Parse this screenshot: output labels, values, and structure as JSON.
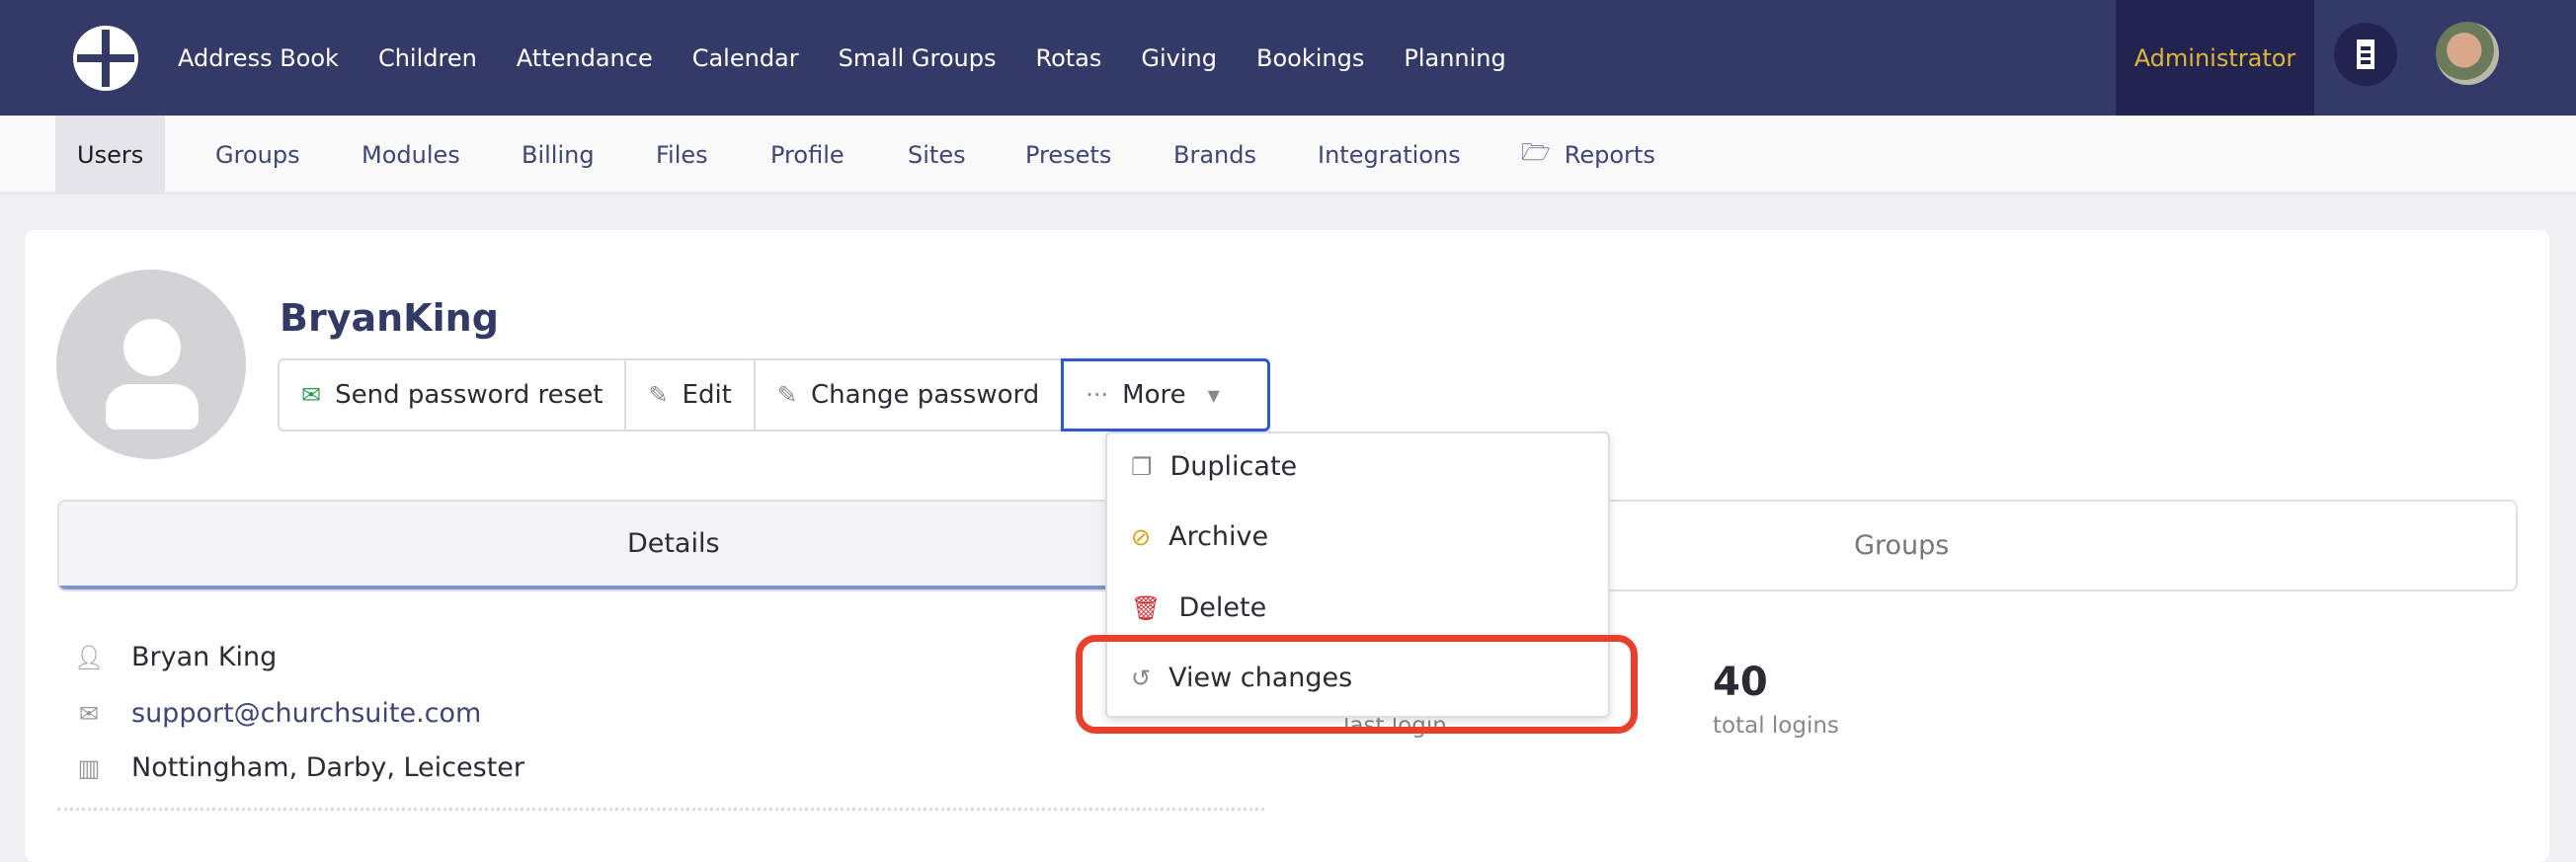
{
  "header": {
    "nav": [
      "Address Book",
      "Children",
      "Attendance",
      "Calendar",
      "Small Groups",
      "Rotas",
      "Giving",
      "Bookings",
      "Planning"
    ],
    "role": "Administrator"
  },
  "subnav": {
    "items": [
      "Users",
      "Groups",
      "Modules",
      "Billing",
      "Files",
      "Profile",
      "Sites",
      "Presets",
      "Brands",
      "Integrations",
      "Reports"
    ]
  },
  "user": {
    "username": "BryanKing",
    "full_name": "Bryan King",
    "email": "support@churchsuite.com",
    "sites": "Nottingham, Darby, Leicester"
  },
  "actions": {
    "send_reset": "Send password reset",
    "edit": "Edit",
    "change_password": "Change password",
    "more": "More"
  },
  "menu": {
    "items": [
      "Duplicate",
      "Archive",
      "Delete",
      "View changes"
    ]
  },
  "tabs": [
    "Details",
    "Groups"
  ],
  "stats": {
    "last_login_label": "last login",
    "total_logins": "40",
    "total_logins_label": "total logins"
  },
  "colors": {
    "brand": "#343a68",
    "accent": "#e0b53a",
    "highlight": "#e8402a"
  }
}
